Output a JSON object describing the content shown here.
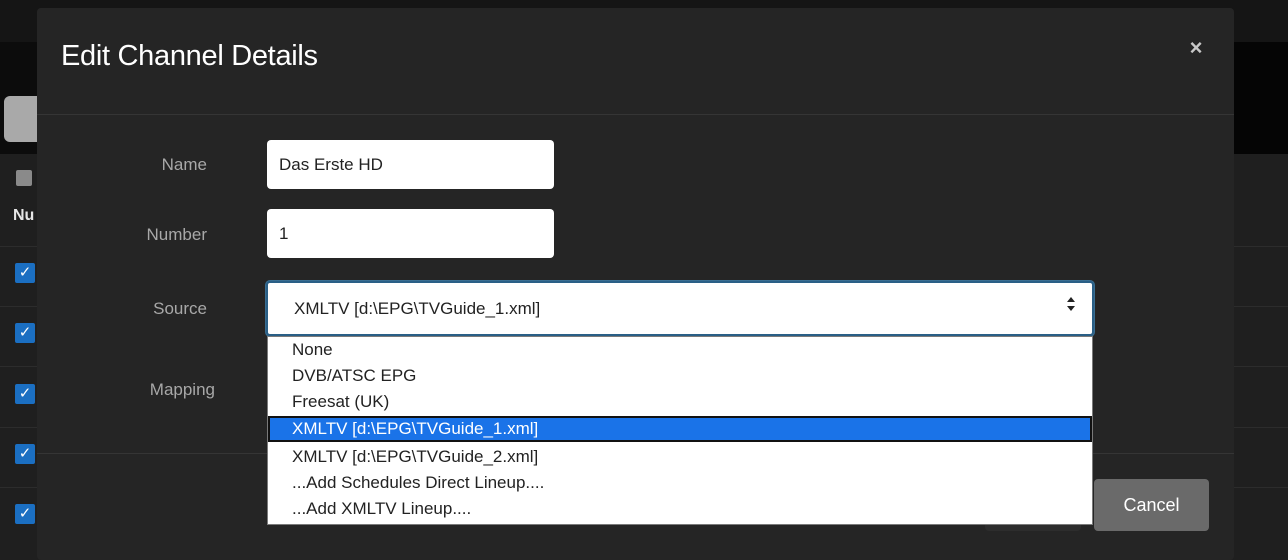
{
  "background": {
    "column_header": "Nu",
    "check_mark": "✓"
  },
  "modal": {
    "title": "Edit Channel Details",
    "close_icon": "×",
    "fields": {
      "name_label": "Name",
      "name_value": "Das Erste HD",
      "number_label": "Number",
      "number_value": "1",
      "source_label": "Source",
      "source_value": "XMLTV [d:\\EPG\\TVGuide_1.xml]",
      "mapping_label": "Mapping"
    },
    "source_options": [
      "None",
      "DVB/ATSC EPG",
      "Freesat (UK)",
      "XMLTV [d:\\EPG\\TVGuide_1.xml]",
      "XMLTV [d:\\EPG\\TVGuide_2.xml]",
      "...Add Schedules Direct Lineup....",
      "...Add XMLTV Lineup...."
    ],
    "selected_option_index": 3,
    "cancel_label": "Cancel"
  },
  "colors": {
    "selection": "#1a73e8",
    "checkbox": "#1b6fc2",
    "modal_bg": "#252525"
  }
}
